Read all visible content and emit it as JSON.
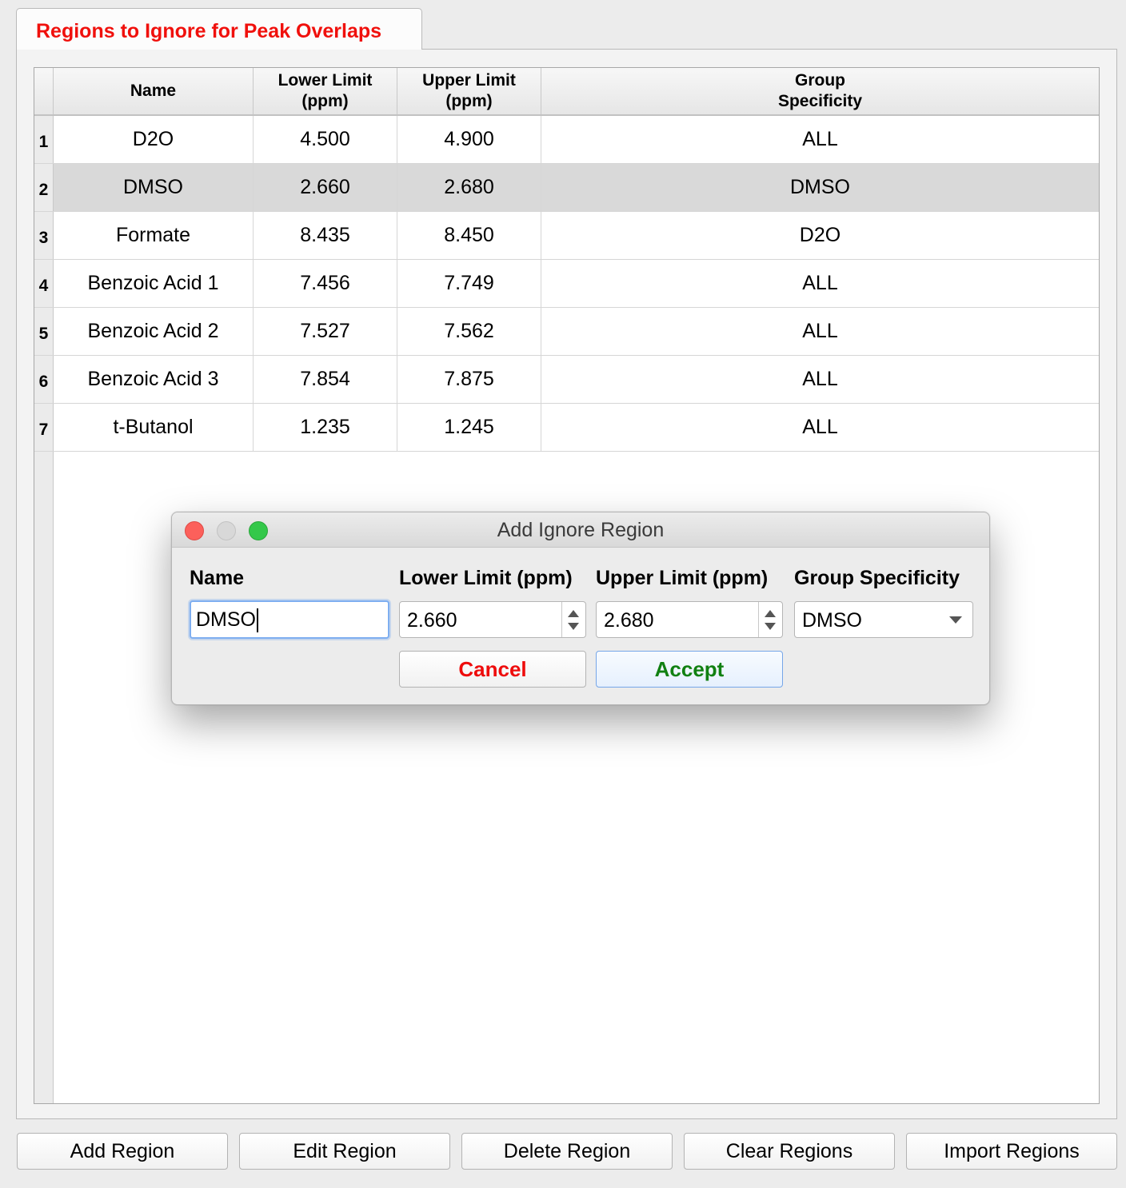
{
  "tab": {
    "label": "Regions to Ignore for Peak Overlaps",
    "color": "#f0100c"
  },
  "table": {
    "headers": {
      "name": "Name",
      "lower": [
        "Lower Limit",
        "(ppm)"
      ],
      "upper": [
        "Upper Limit",
        "(ppm)"
      ],
      "group": [
        "Group",
        "Specificity"
      ]
    },
    "selected_row": 2,
    "rows": [
      {
        "num": "1",
        "name": "D2O",
        "lower": "4.500",
        "upper": "4.900",
        "group": "ALL"
      },
      {
        "num": "2",
        "name": "DMSO",
        "lower": "2.660",
        "upper": "2.680",
        "group": "DMSO"
      },
      {
        "num": "3",
        "name": "Formate",
        "lower": "8.435",
        "upper": "8.450",
        "group": "D2O"
      },
      {
        "num": "4",
        "name": "Benzoic Acid 1",
        "lower": "7.456",
        "upper": "7.749",
        "group": "ALL"
      },
      {
        "num": "5",
        "name": "Benzoic Acid 2",
        "lower": "7.527",
        "upper": "7.562",
        "group": "ALL"
      },
      {
        "num": "6",
        "name": "Benzoic Acid 3",
        "lower": "7.854",
        "upper": "7.875",
        "group": "ALL"
      },
      {
        "num": "7",
        "name": "t-Butanol",
        "lower": "1.235",
        "upper": "1.245",
        "group": "ALL"
      }
    ]
  },
  "dialog": {
    "title": "Add Ignore Region",
    "labels": {
      "name": "Name",
      "lower": "Lower Limit (ppm)",
      "upper": "Upper Limit (ppm)",
      "group": "Group Specificity"
    },
    "values": {
      "name": "DMSO",
      "lower": "2.660",
      "upper": "2.680",
      "group": "DMSO"
    },
    "cancel_label": "Cancel",
    "accept_label": "Accept",
    "cancel_color": "#ee0c0c",
    "accept_color": "#118011"
  },
  "buttons": {
    "add": "Add Region",
    "edit": "Edit Region",
    "delete": "Delete Region",
    "clear": "Clear Regions",
    "import": "Import Regions"
  }
}
